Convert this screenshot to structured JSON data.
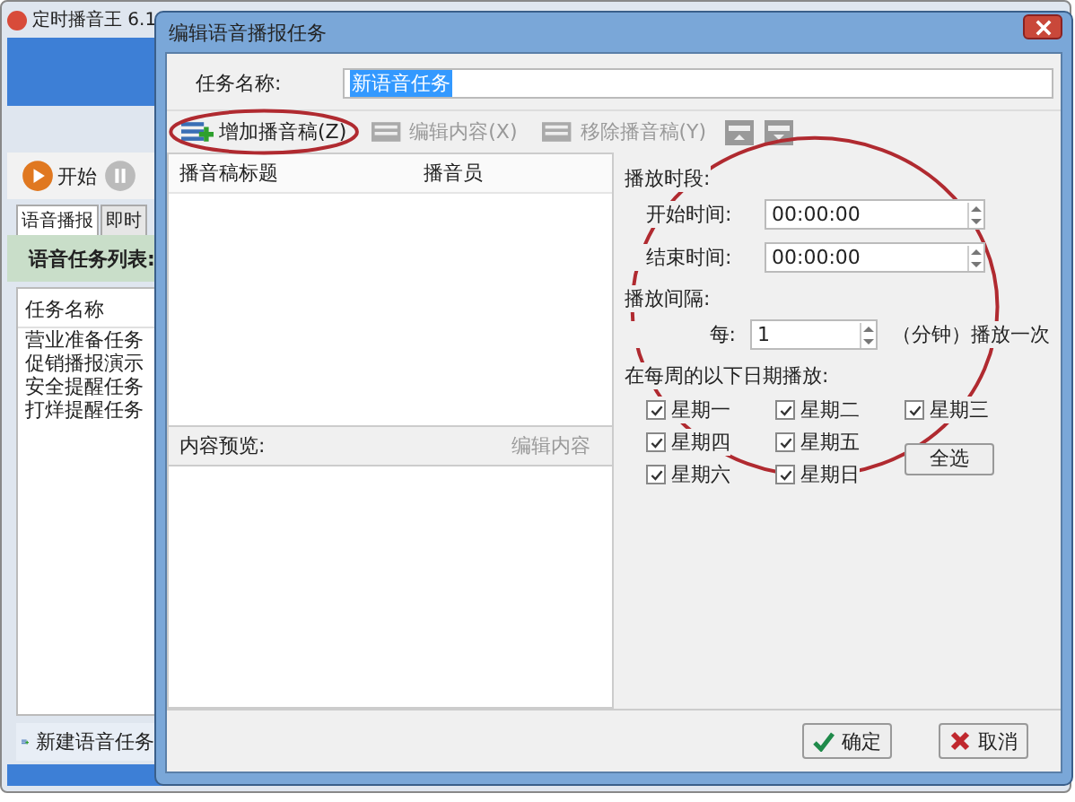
{
  "main_window": {
    "title": "定时播音王 6.1",
    "toolbar": [
      {
        "label": "开始",
        "kind": "play"
      },
      {
        "kind": "pause"
      }
    ],
    "tabs": [
      {
        "label": "语音播报",
        "selected": true
      },
      {
        "label": "即时",
        "selected": false
      }
    ],
    "list_title": "语音任务列表:",
    "column": "任务名称",
    "rows": [
      "营业准备任务",
      "促销播报演示",
      "安全提醒任务",
      "打烊提醒任务"
    ],
    "new_button": "新建语音任务"
  },
  "dialog": {
    "title": "编辑语音播报任务",
    "name_label": "任务名称:",
    "name_value": "新语音任务",
    "toolbar": [
      {
        "label": "增加播音稿(Z)",
        "disabled": false,
        "highlighted": true
      },
      {
        "label": "编辑内容(X)",
        "disabled": true,
        "highlighted": false
      },
      {
        "label": "移除播音稿(Y)",
        "disabled": true,
        "highlighted": false
      }
    ],
    "columns": [
      "播音稿标题",
      "播音员"
    ],
    "preview_label": "内容预览:",
    "preview_edit": "编辑内容",
    "period_label": "播放时段:",
    "start_label": "开始时间:",
    "start_value": "00:00:00",
    "end_label": "结束时间:",
    "end_value": "00:00:00",
    "interval_label": "播放间隔:",
    "every_label": "每:",
    "every_value": "1",
    "every_unit": "（分钟）播放一次",
    "days_label": "在每周的以下日期播放:",
    "days": [
      {
        "label": "星期一",
        "checked": true
      },
      {
        "label": "星期二",
        "checked": true
      },
      {
        "label": "星期三",
        "checked": true
      },
      {
        "label": "星期四",
        "checked": true
      },
      {
        "label": "星期五",
        "checked": true
      },
      {
        "label": "星期六",
        "checked": true
      },
      {
        "label": "星期日",
        "checked": true
      }
    ],
    "select_all": "全选",
    "ok": "确定",
    "cancel": "取消"
  }
}
